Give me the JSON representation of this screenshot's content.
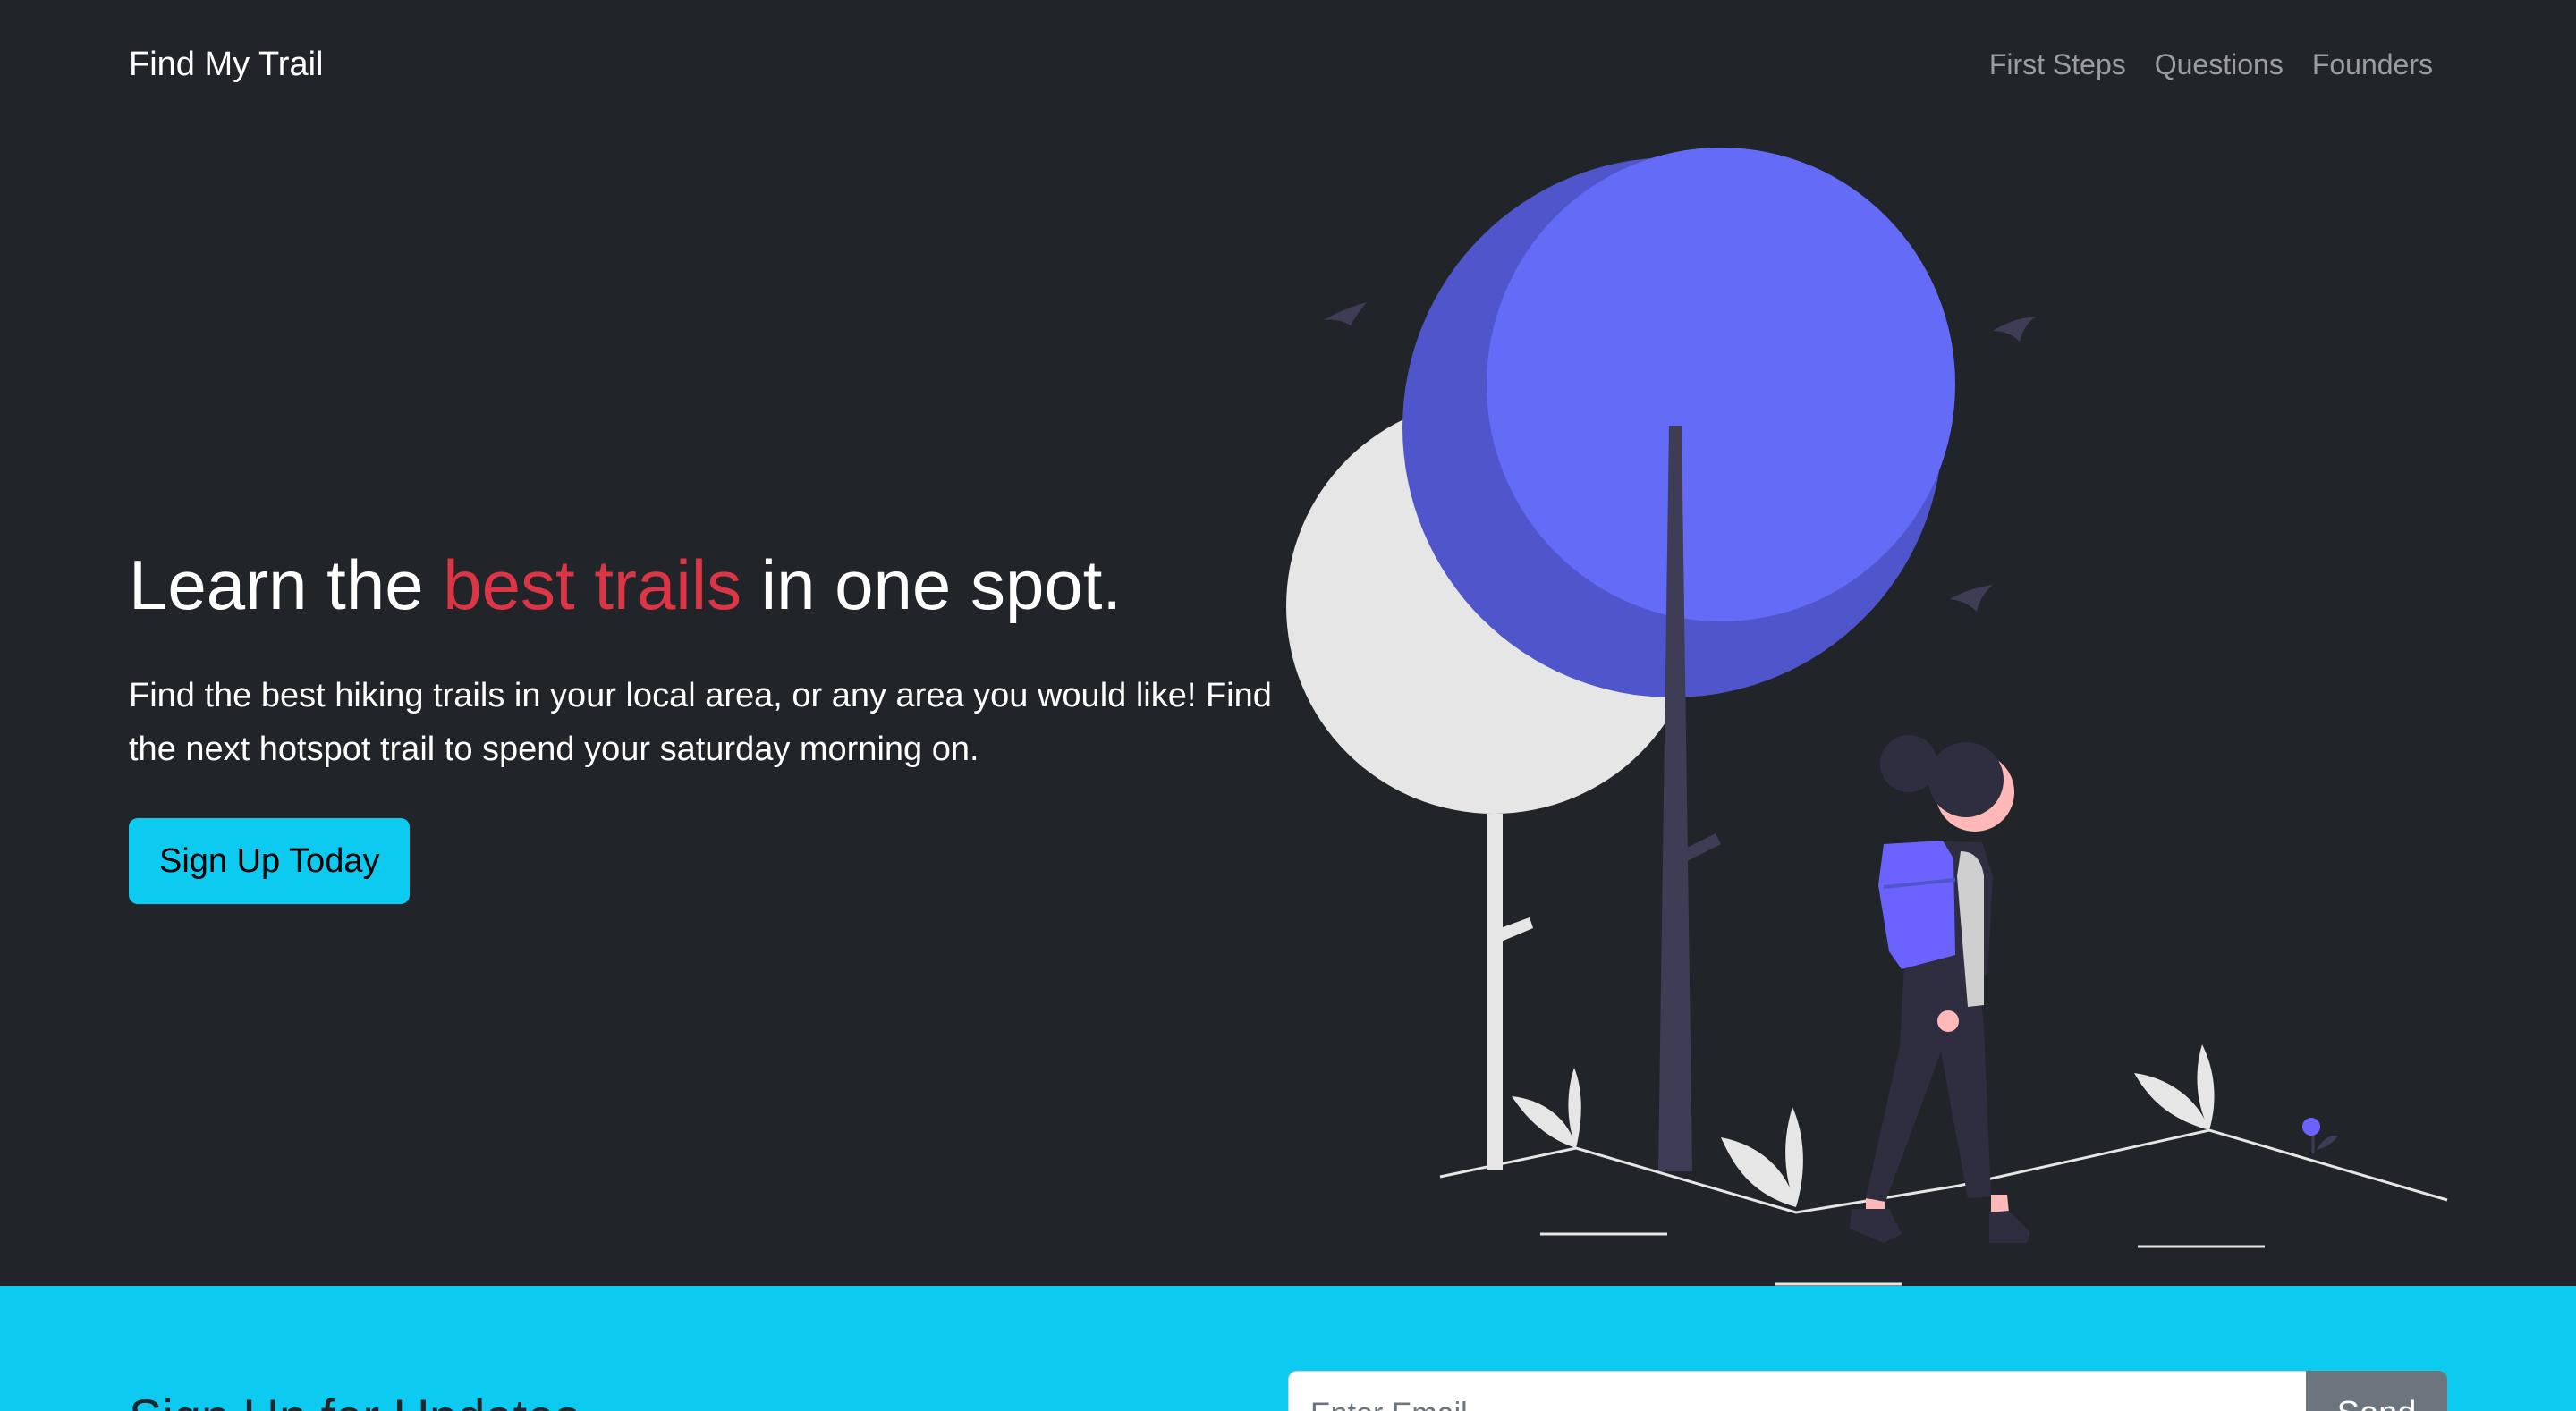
{
  "nav": {
    "brand": "Find My Trail",
    "links": [
      "First Steps",
      "Questions",
      "Founders"
    ]
  },
  "hero": {
    "title_before": "Learn the ",
    "title_accent": "best trails",
    "title_after": " in one spot.",
    "lead": "Find the best hiking trails in your local area, or any area you would like! Find the next hotspot trail to spend your saturday morning on.",
    "cta_label": "Sign Up Today"
  },
  "signup": {
    "heading": "Sign Up for Updates",
    "email_placeholder": "Enter Email",
    "send_label": "Send"
  },
  "colors": {
    "background": "#212529",
    "accent_red": "#dc3545",
    "cyan": "#0dcaf0",
    "tree_blue": "#6c63ff",
    "tree_light": "#e6e6e6"
  }
}
